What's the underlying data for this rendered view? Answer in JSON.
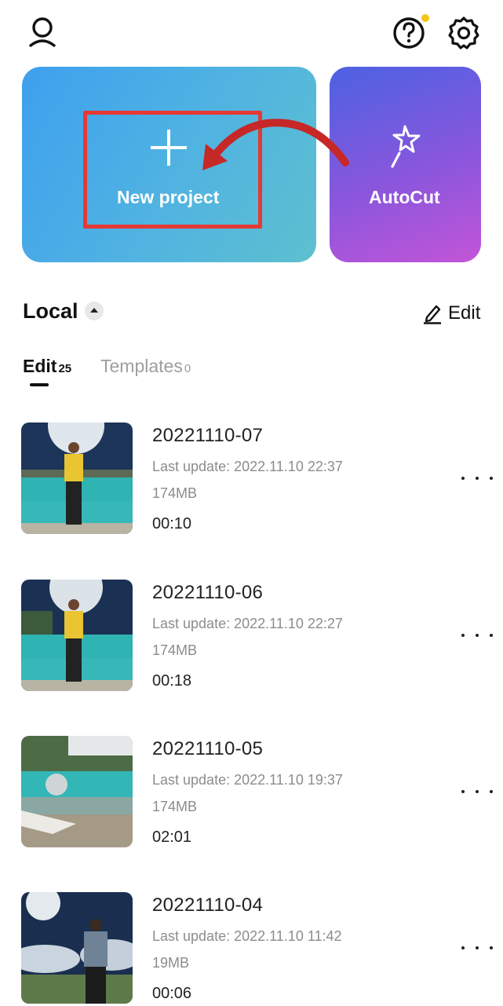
{
  "header": {
    "profile_icon": "user-icon",
    "help_icon": "question-circle-icon",
    "settings_icon": "gear-icon",
    "notification_dot_color": "#f6c416"
  },
  "actions": {
    "new_project": {
      "label": "New project",
      "icon": "plus-icon"
    },
    "autocut": {
      "label": "AutoCut",
      "icon": "magic-wand-icon"
    },
    "highlight_color": "#e53935"
  },
  "local": {
    "title": "Local",
    "edit_label": "Edit"
  },
  "tabs": [
    {
      "label": "Edit",
      "count": "25",
      "active": true
    },
    {
      "label": "Templates",
      "count": "0",
      "active": false
    }
  ],
  "projects": [
    {
      "name": "20221110-07",
      "last_update": "Last update: 2022.11.10 22:37",
      "size": "174MB",
      "duration": "00:10"
    },
    {
      "name": "20221110-06",
      "last_update": "Last update: 2022.11.10 22:27",
      "size": "174MB",
      "duration": "00:18"
    },
    {
      "name": "20221110-05",
      "last_update": "Last update: 2022.11.10 19:37",
      "size": "174MB",
      "duration": "02:01"
    },
    {
      "name": "20221110-04",
      "last_update": "Last update: 2022.11.10 11:42",
      "size": "19MB",
      "duration": "00:06"
    }
  ]
}
